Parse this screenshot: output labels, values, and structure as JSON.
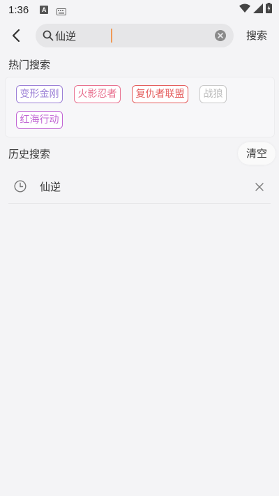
{
  "status_bar": {
    "time": "1:36",
    "icons": [
      "a-notification-icon",
      "keyboard-icon",
      "wifi-icon",
      "signal-icon",
      "battery-charging-icon"
    ]
  },
  "top_bar": {
    "search_value": "仙逆",
    "search_button_label": "搜索"
  },
  "hot_search": {
    "title": "热门搜索",
    "tags": [
      {
        "label": "变形金刚",
        "color": "#9b7fd6"
      },
      {
        "label": "火影忍者",
        "color": "#e86f8e"
      },
      {
        "label": "复仇者联盟",
        "color": "#e45c5c"
      },
      {
        "label": "战狼",
        "color": "#bdbdbd"
      },
      {
        "label": "红海行动",
        "color": "#c165d4"
      }
    ]
  },
  "history": {
    "title": "历史搜索",
    "clear_label": "清空",
    "items": [
      {
        "label": "仙逆"
      }
    ]
  },
  "colors": {
    "background": "#f4f4f6",
    "search_box": "#e6e6e8",
    "caret": "#f09a57"
  }
}
